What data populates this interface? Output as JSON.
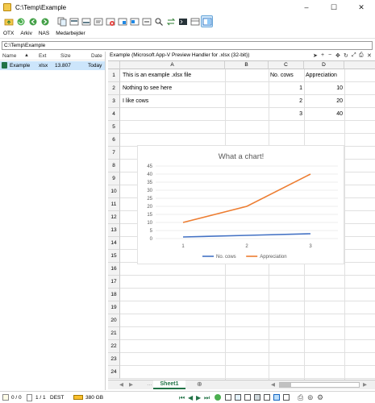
{
  "window": {
    "title": "C:\\Temp\\Example",
    "controls": [
      "–",
      "☐",
      "✕"
    ]
  },
  "toolbar": {
    "buttons": [
      "up-folder",
      "refresh",
      "back",
      "forward",
      "copy",
      "move",
      "new-folder",
      "rename",
      "delete",
      "pack",
      "unpack",
      "compare",
      "search",
      "sync",
      "terminal",
      "view",
      "preview"
    ]
  },
  "menu": [
    "OTX",
    "Arkiv",
    "NAS",
    "Medarbejder"
  ],
  "path": "C:\\Temp\\Example",
  "filelist": {
    "columns": {
      "name": "Name",
      "ext": "Ext",
      "size": "Size",
      "date": "Date"
    },
    "rows": [
      {
        "name": "Example",
        "ext": "xlsx",
        "size": "13.807",
        "date": "Today"
      }
    ]
  },
  "preview": {
    "header": "Example (Microsoft App-V Preview Handler for .xlsx (32-bit))",
    "columns": [
      "A",
      "B",
      "C",
      "D"
    ],
    "rows": [
      "1",
      "2",
      "3",
      "4",
      "5",
      "6",
      "7",
      "8",
      "9",
      "10",
      "11",
      "12",
      "13",
      "14",
      "15",
      "16",
      "17",
      "18",
      "19",
      "20",
      "21",
      "22",
      "23",
      "24"
    ],
    "cells": {
      "a1": "This is an example .xlsx file",
      "c1": "No. cows",
      "d1": "Appreciation",
      "a2": "Nothing to see here",
      "c2": "1",
      "d2": "10",
      "a3": "I like cows",
      "c3": "2",
      "d3": "20",
      "c4": "3",
      "d4": "40"
    },
    "sheet_tab": "Sheet1"
  },
  "chart_data": {
    "type": "line",
    "title": "What a chart!",
    "categories": [
      "1",
      "2",
      "3"
    ],
    "series": [
      {
        "name": "No. cows",
        "values": [
          1,
          2,
          3
        ],
        "color": "#4472c4"
      },
      {
        "name": "Appreciation",
        "values": [
          10,
          20,
          40
        ],
        "color": "#ed7d31"
      }
    ],
    "ylim": [
      0,
      45
    ],
    "yticks": [
      "0",
      "5",
      "10",
      "15",
      "20",
      "25",
      "30",
      "35",
      "40",
      "45"
    ],
    "grid": true,
    "legend": "bottom"
  },
  "status": {
    "selection": "0 / 0",
    "files": "1 / 1",
    "drive": "DEST",
    "free": "380 GB"
  }
}
